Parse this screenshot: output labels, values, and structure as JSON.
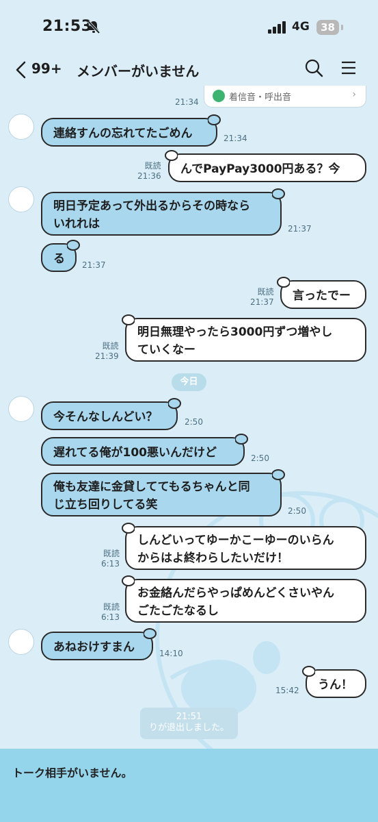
{
  "status_bar": {
    "time": "21:53",
    "network": "4G",
    "battery": "38"
  },
  "header": {
    "back_count": "99+",
    "title": "メンバーがいません"
  },
  "music_card": {
    "label": "着信音・呼出音",
    "time": "21:34"
  },
  "messages": [
    {
      "dir": "in",
      "text": [
        "連絡すんの忘れてたごめん"
      ],
      "time": "21:34"
    },
    {
      "dir": "out",
      "read": "既読",
      "text": [
        "んでPayPay3000円ある？今"
      ],
      "time": "21:36"
    },
    {
      "dir": "in",
      "text": [
        "明日予定あって外出るからその時なら",
        "いれれは"
      ],
      "time": "21:37"
    },
    {
      "dir": "in",
      "text": [
        "る"
      ],
      "time": "21:37"
    },
    {
      "dir": "out",
      "read": "既読",
      "text": [
        "言ったでー"
      ],
      "time": "21:37"
    },
    {
      "dir": "out",
      "read": "既読",
      "text": [
        "明日無理やったら3000円ずつ増やし",
        "ていくなー"
      ],
      "time": "21:39"
    },
    {
      "dir": "in",
      "text": [
        "今そんなしんどい？"
      ],
      "time": "2:50"
    },
    {
      "dir": "in",
      "text": [
        "遅れてる俺が100悪いんだけど"
      ],
      "time": "2:50"
    },
    {
      "dir": "in",
      "text": [
        "俺も友達に金貸しててもるちゃんと同",
        "じ立ち回りしてる笑"
      ],
      "time": "2:50"
    },
    {
      "dir": "out",
      "read": "既読",
      "text": [
        "しんどいってゆーかこーゆーのいらん",
        "からはよ終わらしたいだけ！"
      ],
      "time": "6:13"
    },
    {
      "dir": "out",
      "read": "既読",
      "text": [
        "お金絡んだらやっぱめんどくさいやん",
        "ごたごたなるし"
      ],
      "time": "6:13"
    },
    {
      "dir": "in",
      "text": [
        "あねおけすまん"
      ],
      "time": "14:10"
    },
    {
      "dir": "out",
      "text": [
        "うん！"
      ],
      "time": "15:42"
    }
  ],
  "date_separator": "今日",
  "system_message": {
    "time": "21:51",
    "text": "りが退出しました。"
  },
  "footer": {
    "text": "トーク相手がいません。"
  },
  "colors": {
    "background": "#dbeef8",
    "incoming_bubble": "#a8d7ee",
    "outgoing_bubble": "#ffffff",
    "footer": "#95d5ec"
  }
}
